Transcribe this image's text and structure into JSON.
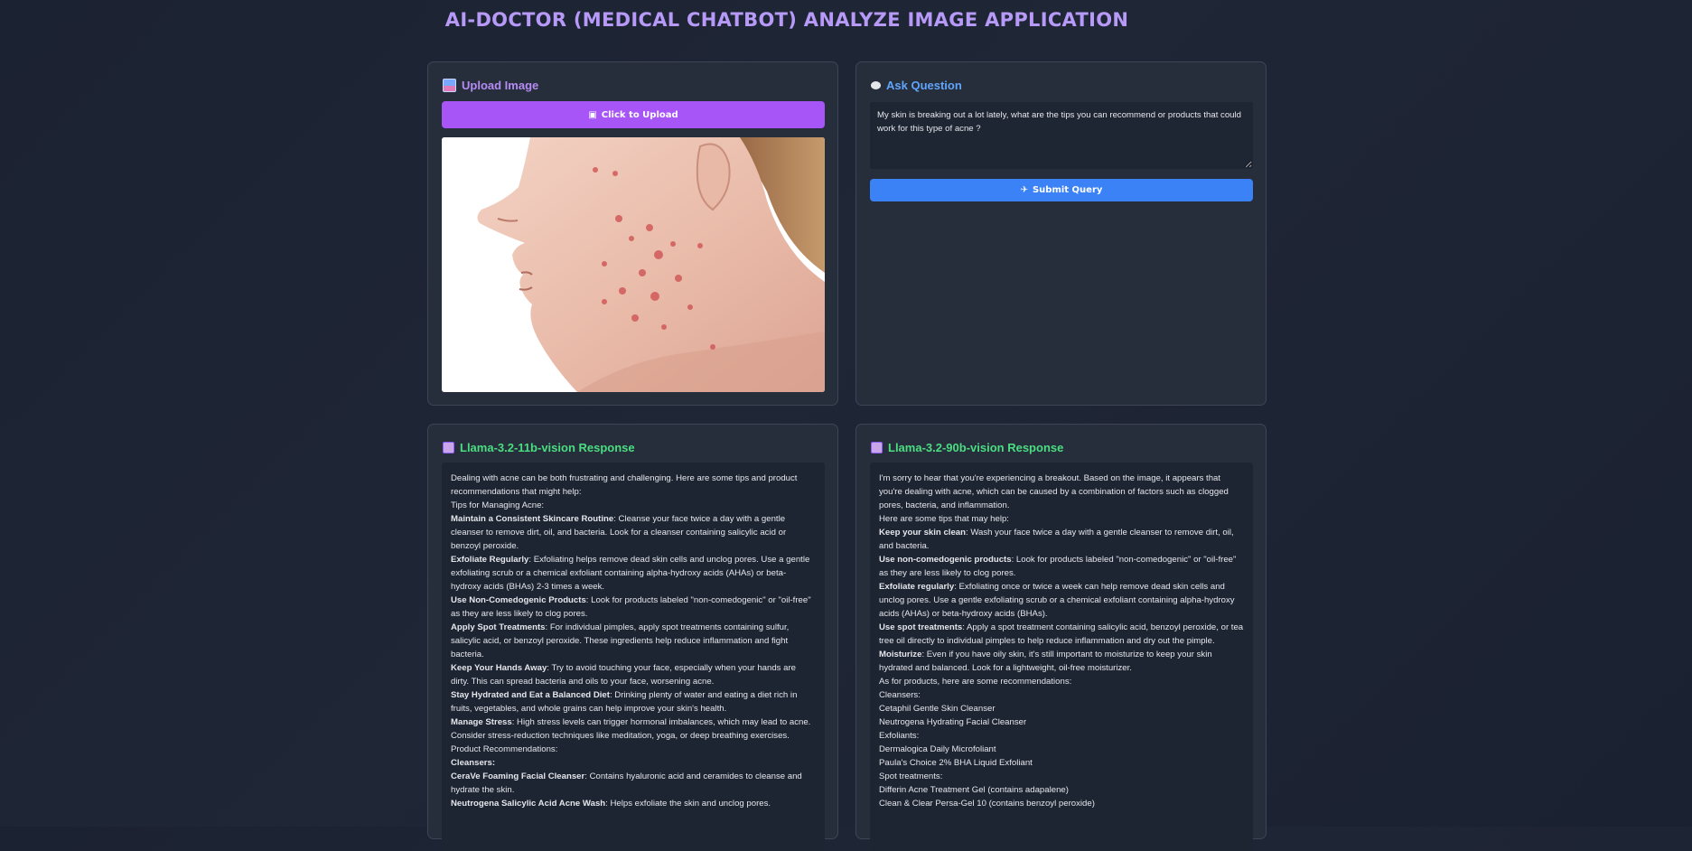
{
  "app": {
    "title": "AI-DOCTOR (MEDICAL CHATBOT) ANALYZE IMAGE APPLICATION"
  },
  "upload": {
    "heading": "Upload Image",
    "button_label": "Click to Upload",
    "image_description": "photo",
    "colors": {
      "heading": "#b58cf4",
      "button": "#a855f7"
    }
  },
  "ask": {
    "heading": "Ask Question",
    "question": "My skin is breaking out a lot lately, what are the tips you can recommend or products that could work for this type of acne ?",
    "submit_label": "Submit Query",
    "colors": {
      "heading": "#60a5fa",
      "button": "#3b82f6"
    }
  },
  "response_11b": {
    "heading": "Llama-3.2-11b-vision Response",
    "lines": [
      {
        "bold": "",
        "text": "Dealing with acne can be both frustrating and challenging. Here are some tips and product recommendations that might help:"
      },
      {
        "bold": "",
        "text": "Tips for Managing Acne:"
      },
      {
        "bold": "Maintain a Consistent Skincare Routine",
        "text": ": Cleanse your face twice a day with a gentle cleanser to remove dirt, oil, and bacteria. Look for a cleanser containing salicylic acid or benzoyl peroxide."
      },
      {
        "bold": "Exfoliate Regularly",
        "text": ": Exfoliating helps remove dead skin cells and unclog pores. Use a gentle exfoliating scrub or a chemical exfoliant containing alpha-hydroxy acids (AHAs) or beta-hydroxy acids (BHAs) 2-3 times a week."
      },
      {
        "bold": "Use Non-Comedogenic Products",
        "text": ": Look for products labeled \"non-comedogenic\" or \"oil-free\" as they are less likely to clog pores."
      },
      {
        "bold": "Apply Spot Treatments",
        "text": ": For individual pimples, apply spot treatments containing sulfur, salicylic acid, or benzoyl peroxide. These ingredients help reduce inflammation and fight bacteria."
      },
      {
        "bold": "Keep Your Hands Away",
        "text": ": Try to avoid touching your face, especially when your hands are dirty. This can spread bacteria and oils to your face, worsening acne."
      },
      {
        "bold": "Stay Hydrated and Eat a Balanced Diet",
        "text": ": Drinking plenty of water and eating a diet rich in fruits, vegetables, and whole grains can help improve your skin's health."
      },
      {
        "bold": "Manage Stress",
        "text": ": High stress levels can trigger hormonal imbalances, which may lead to acne. Consider stress-reduction techniques like meditation, yoga, or deep breathing exercises."
      },
      {
        "bold": "",
        "text": "Product Recommendations:"
      },
      {
        "bold": "Cleansers:",
        "text": ""
      },
      {
        "bold": "CeraVe Foaming Facial Cleanser",
        "text": ": Contains hyaluronic acid and ceramides to cleanse and hydrate the skin."
      },
      {
        "bold": "Neutrogena Salicylic Acid Acne Wash",
        "text": ": Helps exfoliate the skin and unclog pores."
      }
    ]
  },
  "response_90b": {
    "heading": "Llama-3.2-90b-vision Response",
    "lines": [
      {
        "bold": "",
        "text": "I'm sorry to hear that you're experiencing a breakout. Based on the image, it appears that you're dealing with acne, which can be caused by a combination of factors such as clogged pores, bacteria, and inflammation."
      },
      {
        "bold": "",
        "text": "Here are some tips that may help:"
      },
      {
        "bold": "Keep your skin clean",
        "text": ": Wash your face twice a day with a gentle cleanser to remove dirt, oil, and bacteria."
      },
      {
        "bold": "Use non-comedogenic products",
        "text": ": Look for products labeled \"non-comedogenic\" or \"oil-free\" as they are less likely to clog pores."
      },
      {
        "bold": "Exfoliate regularly",
        "text": ": Exfoliating once or twice a week can help remove dead skin cells and unclog pores. Use a gentle exfoliating scrub or a chemical exfoliant containing alpha-hydroxy acids (AHAs) or beta-hydroxy acids (BHAs)."
      },
      {
        "bold": "Use spot treatments",
        "text": ": Apply a spot treatment containing salicylic acid, benzoyl peroxide, or tea tree oil directly to individual pimples to help reduce inflammation and dry out the pimple."
      },
      {
        "bold": "Moisturize",
        "text": ": Even if you have oily skin, it's still important to moisturize to keep your skin hydrated and balanced. Look for a lightweight, oil-free moisturizer."
      },
      {
        "bold": "",
        "text": "As for products, here are some recommendations:"
      },
      {
        "bold": "",
        "text": "Cleansers:"
      },
      {
        "bold": "",
        "text": "Cetaphil Gentle Skin Cleanser"
      },
      {
        "bold": "",
        "text": "Neutrogena Hydrating Facial Cleanser"
      },
      {
        "bold": "",
        "text": "Exfoliants:"
      },
      {
        "bold": "",
        "text": "Dermalogica Daily Microfoliant"
      },
      {
        "bold": "",
        "text": "Paula's Choice 2% BHA Liquid Exfoliant"
      },
      {
        "bold": "",
        "text": "Spot treatments:"
      },
      {
        "bold": "",
        "text": "Differin Acne Treatment Gel (contains adapalene)"
      },
      {
        "bold": "",
        "text": "Clean & Clear Persa-Gel 10 (contains benzoyl peroxide)"
      }
    ]
  },
  "theme": {
    "title_color": "#b79af7",
    "response_heading_color": "#4ade80",
    "icons": {
      "upload": "image-icon",
      "ask": "speech-bubble-icon",
      "submit": "rocket-icon",
      "camera": "camera-icon",
      "robot": "robot-icon"
    }
  }
}
